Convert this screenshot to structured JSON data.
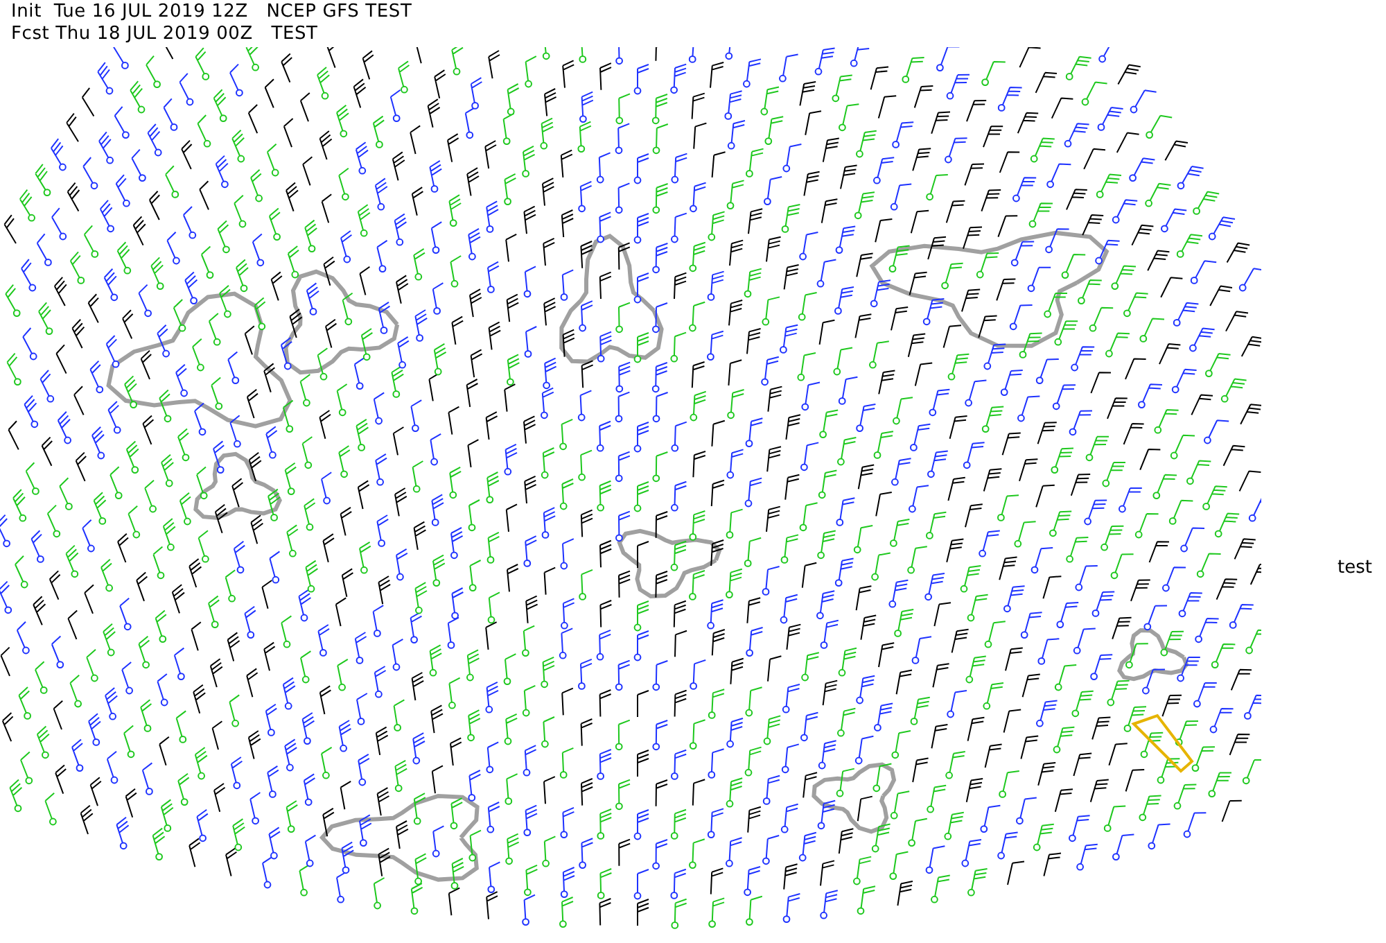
{
  "header": {
    "lines": [
      "Init  Tue 16 JUL 2019 12Z   NCEP GFS TEST",
      "Fcst Thu 18 JUL 2019 00Z   TEST"
    ]
  },
  "side_label": "test"
}
